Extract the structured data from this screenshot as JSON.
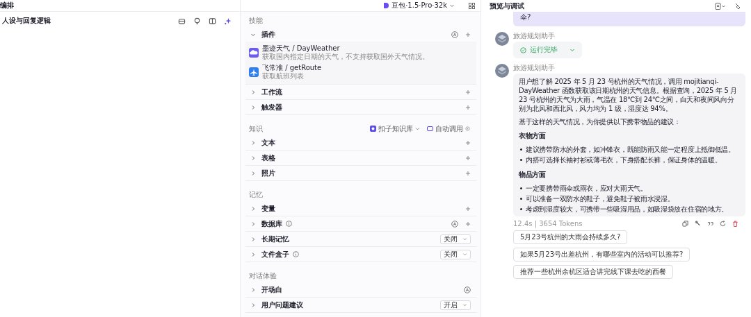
{
  "topbar": {
    "title": "编排",
    "model": "豆包·1.5·Pro·32k"
  },
  "persona": {
    "title": "人设与回复逻辑"
  },
  "sections": [
    {
      "title": "技能",
      "rows": [
        {
          "label": "插件",
          "expanded": true,
          "kind": "auto_add",
          "info": false,
          "plugins": [
            {
              "name": "墨迹天气 / DayWeather",
              "desc": "获取国内指定日期的天气，不支持获取国外天气情况。"
            },
            {
              "name": "飞常准 / getRoute",
              "desc": "获取航班列表"
            }
          ]
        },
        {
          "label": "工作流",
          "expanded": false,
          "kind": "add",
          "info": false
        },
        {
          "label": "触发器",
          "expanded": false,
          "kind": "add",
          "info": false
        }
      ]
    },
    {
      "title": "知识",
      "extras": [
        {
          "label": "扣子知识库",
          "kind": "dropdown"
        },
        {
          "label": "自动调用",
          "kind": "setting"
        }
      ],
      "rows": [
        {
          "label": "文本",
          "expanded": false,
          "kind": "add",
          "info": false
        },
        {
          "label": "表格",
          "expanded": false,
          "kind": "add",
          "info": false
        },
        {
          "label": "照片",
          "expanded": false,
          "kind": "add",
          "info": false
        }
      ]
    },
    {
      "title": "记忆",
      "rows": [
        {
          "label": "变量",
          "expanded": false,
          "kind": "add",
          "info": false
        },
        {
          "label": "数据库",
          "expanded": false,
          "kind": "auto_add",
          "info": true
        },
        {
          "label": "长期记忆",
          "expanded": false,
          "kind": "select",
          "value": "关闭",
          "info": false
        },
        {
          "label": "文件盒子",
          "expanded": false,
          "kind": "select",
          "value": "关闭",
          "info": true
        }
      ]
    },
    {
      "title": "对话体验",
      "rows": [
        {
          "label": "开场白",
          "expanded": false,
          "kind": "auto",
          "info": false
        },
        {
          "label": "用户问题建议",
          "expanded": false,
          "kind": "select",
          "value": "开启",
          "info": false
        }
      ]
    }
  ],
  "preview": {
    "title": "预览与调试",
    "user_message": "伞?",
    "messages": [
      {
        "sender": "旅游规划助手",
        "kind": "status",
        "status": "运行完毕"
      },
      {
        "sender": "旅游规划助手",
        "kind": "answer",
        "blocks": [
          {
            "kind": "p",
            "text": "用户想了解 2025 年 5 月 23 号杭州的天气情况，调用 mojitianqi-DayWeather 函数获取该日期杭州的天气信息。根据查询，2025 年 5 月 23 号杭州的天气为大雨，气温在 18℃到 24℃之间，白天和夜间风向分别为北风和西北风，风力均为 1 级，湿度达 94%。"
          },
          {
            "kind": "p",
            "text": "基于这样的天气情况，为你提供以下携带物品的建议："
          },
          {
            "kind": "h",
            "text": "衣物方面"
          },
          {
            "kind": "li",
            "text": "建议携带防水的外套，如冲锋衣，既能防雨又能一定程度上抵御低温。"
          },
          {
            "kind": "li",
            "text": "内搭可选择长袖衬衫或薄毛衣，下身搭配长裤，保证身体的温暖。"
          },
          {
            "kind": "h",
            "text": "物品方面"
          },
          {
            "kind": "li",
            "text": "一定要携带雨伞或雨衣，应对大雨天气。"
          },
          {
            "kind": "li",
            "text": "可以准备一双防水的鞋子，避免鞋子被雨水浸湿。"
          },
          {
            "kind": "li",
            "text": "考虑到湿度较大，可携带一些吸湿用品，如吸湿袋放在住宿的地方。"
          }
        ]
      }
    ],
    "meta": "12.4s | 3654 Tokens",
    "suggestions": [
      "5月23号杭州的大雨会持续多久?",
      "如果5月23号出差杭州，有哪些室内的活动可以推荐?",
      "推荐一些杭州余杭区适合讲完线下课去吃的西餐"
    ]
  }
}
